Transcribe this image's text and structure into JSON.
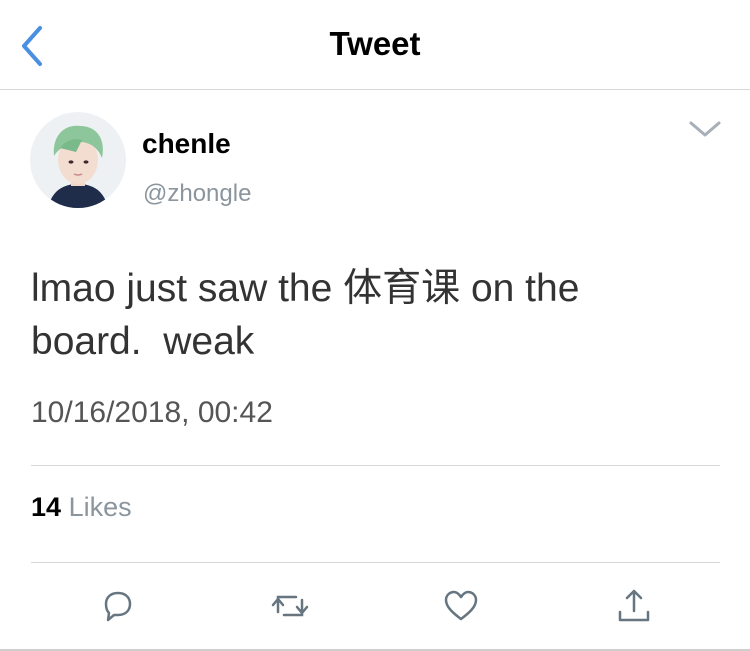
{
  "header": {
    "title": "Tweet"
  },
  "tweet": {
    "display_name": "chenle",
    "handle": "@zhongle",
    "text_line1": "lmao just saw the 体育课 on the",
    "text_line2": "board.  weak",
    "timestamp": "10/16/2018, 00:42",
    "likes_count": "14",
    "likes_label": "Likes"
  },
  "icons": [
    "back-icon",
    "chevron-down-icon",
    "reply-icon",
    "retweet-icon",
    "like-icon",
    "share-icon"
  ],
  "colors": {
    "accent": "#4a90e2",
    "muted": "#8b959e",
    "divider": "#d8d8d8"
  }
}
